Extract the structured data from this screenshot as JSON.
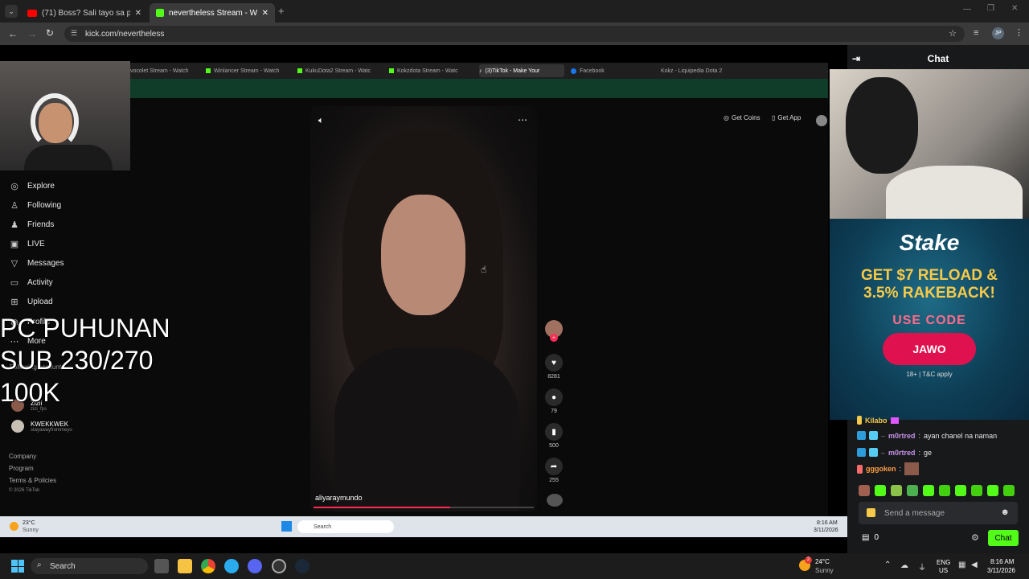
{
  "browser": {
    "tabs": [
      {
        "label": "(71) Boss? Sali tayo sa pinoy he",
        "icon": "youtube-icon",
        "active": false
      },
      {
        "label": "nevertheless Stream - Watch Li",
        "icon": "kick-icon",
        "active": true
      }
    ],
    "url": "kick.com/nevertheless",
    "profile": "JP"
  },
  "inner_browser": {
    "tabs": [
      {
        "label": "vocolet Stream - Watch"
      },
      {
        "label": "Winlancer Stream - Watch"
      },
      {
        "label": "KukuDota2 Stream - Watc"
      },
      {
        "label": "Kokzdota Stream - Watc"
      },
      {
        "label": "(3)TikTok - Make Your"
      },
      {
        "label": "Facebook"
      },
      {
        "label": "Kokz - Liquipedia Dota 2"
      }
    ]
  },
  "tiktok": {
    "nav": [
      {
        "label": "Explore",
        "icon": "compass-icon"
      },
      {
        "label": "Following",
        "icon": "following-icon"
      },
      {
        "label": "Friends",
        "icon": "friends-icon"
      },
      {
        "label": "LIVE",
        "icon": "live-icon"
      },
      {
        "label": "Messages",
        "icon": "messages-icon"
      },
      {
        "label": "Activity",
        "icon": "activity-icon"
      },
      {
        "label": "Upload",
        "icon": "upload-icon"
      },
      {
        "label": "Profile",
        "icon": "profile-icon"
      },
      {
        "label": "More",
        "icon": "more-icon"
      }
    ],
    "following_title": "Following accounts",
    "accounts": [
      {
        "name": "Zizii",
        "handle": "zizi_fps"
      },
      {
        "name": "KWEKKWEK",
        "handle": "stayawayfrommeyo"
      }
    ],
    "footer": [
      "Company",
      "Program",
      "Terms & Policies",
      "© 2026 TikTok"
    ],
    "get_coins": "Get Coins",
    "get_app": "Get App",
    "video_user": "aliyaraymundo",
    "likes": "8281",
    "comments": "79",
    "saves": "500",
    "shares": "255"
  },
  "overlay": {
    "line1": "PC PUHUNAN",
    "line2": "SUB 230/270",
    "line3": "100K"
  },
  "inner_taskbar": {
    "weather_temp": "23°C",
    "weather_desc": "Sunny",
    "search": "Search",
    "time": "8:16 AM",
    "date": "3/11/2026"
  },
  "chat": {
    "title": "Chat",
    "ad": {
      "brand": "Stake",
      "headline1": "GET $7 RELOAD &",
      "headline2": "3.5% RAKEBACK!",
      "use_code": "USE CODE",
      "code": "JAWO",
      "disclaimer": "18+ | T&C apply"
    },
    "messages": [
      {
        "user": "Kilabo",
        "text": "",
        "color": "#f2c94c"
      },
      {
        "user": "m0rtred",
        "text": "ayan chanel na naman",
        "color": "#c792ea"
      },
      {
        "user": "m0rtred",
        "text": "ge",
        "color": "#c792ea"
      },
      {
        "user": "gggoken",
        "text": "",
        "color": "#ff9f43"
      }
    ],
    "input_placeholder": "Send a message",
    "viewer_count": "0",
    "send_label": "Chat"
  },
  "taskbar": {
    "search": "Search",
    "weather_temp": "24°C",
    "weather_desc": "Sunny",
    "lang1": "ENG",
    "lang2": "US",
    "time": "8:16 AM",
    "date": "3/11/2026",
    "notification_count": "2"
  },
  "colors": {
    "kick_green": "#53fc18",
    "chat_bg": "#18191b",
    "stake_bg": "#0d3d55",
    "code_button": "#e0114f"
  }
}
